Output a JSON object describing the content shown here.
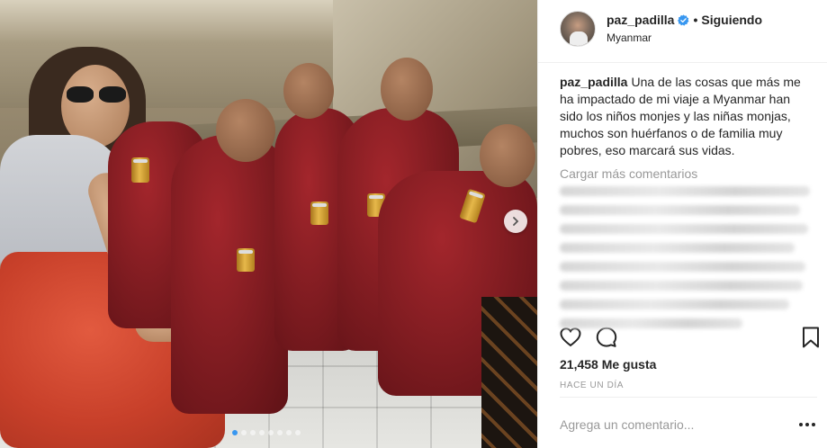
{
  "post": {
    "image": {
      "carousel_total": 8,
      "carousel_active": 1,
      "next_icon": "chevron-right-icon"
    }
  },
  "header": {
    "username": "paz_padilla",
    "verified_icon": "verified-badge-icon",
    "separator": "•",
    "follow_label": "Siguiendo",
    "location": "Myanmar"
  },
  "caption": {
    "username": "paz_padilla",
    "text": "Una de las cosas que más me ha impactado de mi viaje a Myanmar han sido los niños monjes y las niñas monjas, muchos son huérfanos o de familia muy pobres, eso marcará sus vidas."
  },
  "load_more": "Cargar más comentarios",
  "actions": {
    "like_icon": "heart-icon",
    "comment_icon": "comment-icon",
    "save_icon": "bookmark-icon"
  },
  "likes": "21,458 Me gusta",
  "timestamp": "HACE UN DÍA",
  "comment_input": {
    "placeholder": "Agrega un comentario..."
  },
  "more_icon": "more-options-icon",
  "colors": {
    "accent": "#3897f0",
    "text": "#262626",
    "muted": "#999999",
    "border": "#efefef"
  }
}
